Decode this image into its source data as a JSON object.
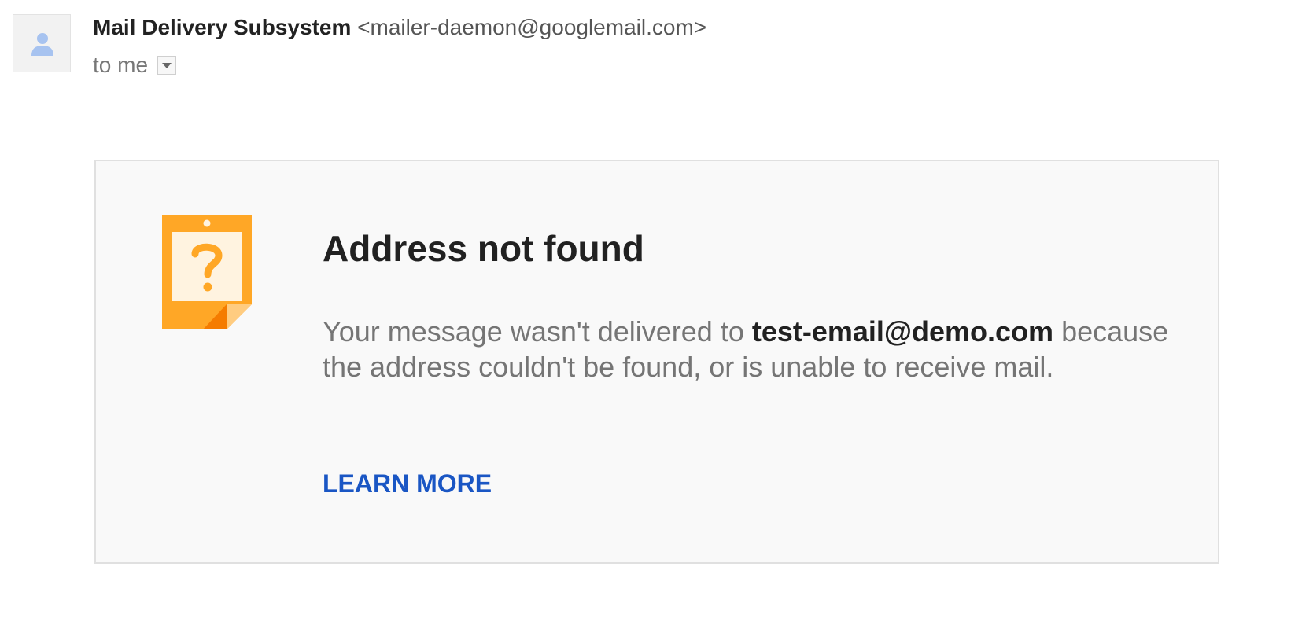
{
  "header": {
    "avatar_icon": "person-icon",
    "sender_name": "Mail Delivery Subsystem",
    "sender_email": "<mailer-daemon@googlemail.com>",
    "recipient_text": "to me",
    "details_icon": "chevron-down-icon"
  },
  "bounce_card": {
    "icon": "question-note-icon",
    "title": "Address not found",
    "message_prefix": "Your message wasn't delivered to ",
    "address": "test-email@demo.com",
    "message_suffix": " because the address couldn't be found, or is unable to receive mail.",
    "learn_more_label": "LEARN MORE"
  },
  "colors": {
    "accent_link": "#1a56c4",
    "icon_orange": "#ffa726",
    "icon_dark_orange": "#f57c00",
    "avatar_person": "#a7c3f0"
  }
}
